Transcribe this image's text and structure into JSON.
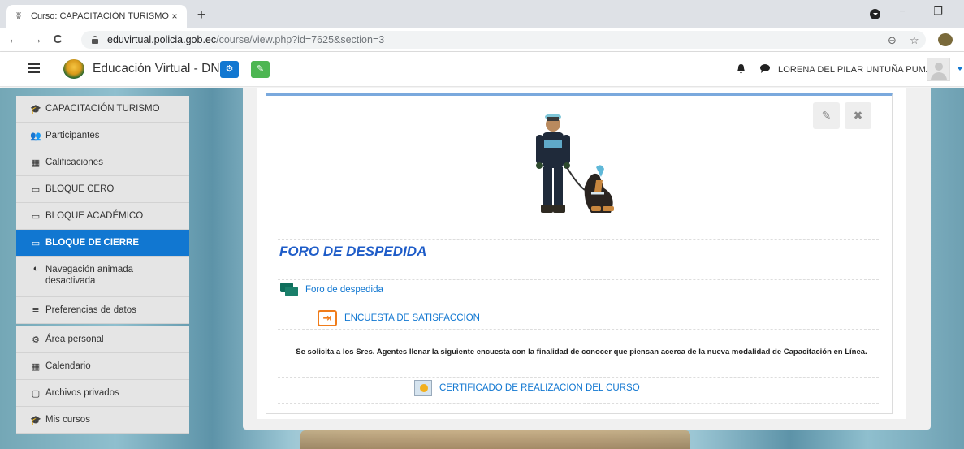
{
  "browser": {
    "tab_title": "Curso: CAPACITACIÓN TURISMO",
    "tab_close": "×",
    "new_tab": "+",
    "url_host": "eduvirtual.policia.gob.ec",
    "url_path": "/course/view.php?id=7625&section=3",
    "back": "←",
    "forward": "→",
    "reload": "C",
    "minimize": "−",
    "restore": "❐",
    "zoom_icon": "⊖",
    "star_icon": "☆"
  },
  "navbar": {
    "brand": "Educación Virtual - DNE",
    "username": "LORENA DEL PILAR UNTUÑA PUMA",
    "btn1_icon": "⚙",
    "btn2_icon": "✎",
    "bell": "🔔",
    "chat": "💬",
    "colors": {
      "btn1": "#1177d1",
      "btn2": "#4db652"
    }
  },
  "sidebar": {
    "items": [
      {
        "label": "CAPACITACIÓN TURISMO",
        "icon": "🎓"
      },
      {
        "label": "Participantes",
        "icon": "👥"
      },
      {
        "label": "Calificaciones",
        "icon": "▦"
      },
      {
        "label": "BLOQUE CERO",
        "icon": "▭"
      },
      {
        "label": "BLOQUE ACADÉMICO",
        "icon": "▭"
      },
      {
        "label": "BLOQUE DE CIERRE",
        "icon": "▭"
      },
      {
        "label": "Navegación animada desactivada",
        "icon": "◐"
      },
      {
        "label": "Preferencias de datos",
        "icon": "≣"
      },
      {
        "label": "Área personal",
        "icon": "⚙"
      },
      {
        "label": "Calendario",
        "icon": "▦"
      },
      {
        "label": "Archivos privados",
        "icon": "▢"
      },
      {
        "label": "Mis cursos",
        "icon": "🎓"
      }
    ],
    "active_index": 5
  },
  "section": {
    "title": "FORO DE DESPEDIDA",
    "edit_icon": "✎",
    "close_icon": "✖",
    "activities": [
      {
        "label": "Foro de despedida",
        "type": "forum"
      },
      {
        "label": "ENCUESTA DE SATISFACCION",
        "type": "feedback",
        "icon": "⇥"
      },
      {
        "label": "CERTIFICADO DE REALIZACION DEL CURSO",
        "type": "certificate"
      }
    ],
    "description": "Se solicita a los Sres. Agentes llenar la siguiente encuesta con la finalidad de conocer que piensan acerca de la nueva modalidad de Capacitación en Línea."
  }
}
